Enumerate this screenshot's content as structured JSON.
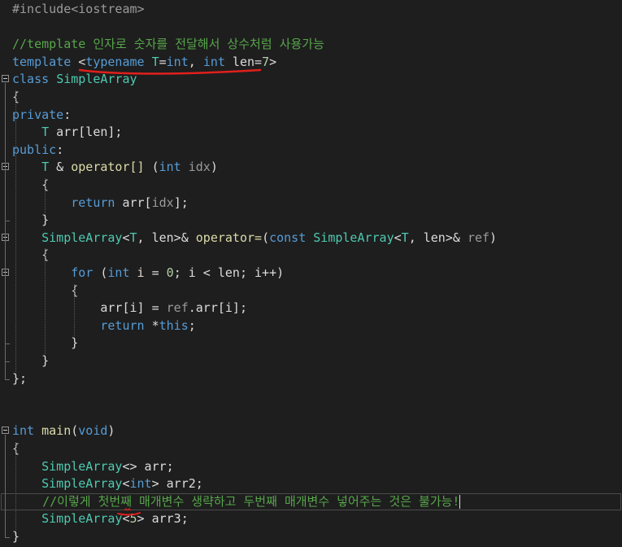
{
  "editor": {
    "lines": [
      [
        {
          "c": "pp",
          "t": "#include<iostream>"
        }
      ],
      [],
      [
        {
          "c": "cm",
          "t": "//template 인자로 숫자를 전달해서 상수처럼 사용가능"
        }
      ],
      [
        {
          "c": "kw",
          "t": "template"
        },
        {
          "c": "tx",
          "t": " <"
        },
        {
          "c": "kw",
          "t": "typename"
        },
        {
          "c": "tx",
          "t": " "
        },
        {
          "c": "ty",
          "t": "T"
        },
        {
          "c": "tx",
          "t": "="
        },
        {
          "c": "kw",
          "t": "int"
        },
        {
          "c": "tx",
          "t": ", "
        },
        {
          "c": "kw",
          "t": "int"
        },
        {
          "c": "tx",
          "t": " len="
        },
        {
          "c": "nm",
          "t": "7"
        },
        {
          "c": "tx",
          "t": ">"
        }
      ],
      [
        {
          "c": "kw",
          "t": "class"
        },
        {
          "c": "tx",
          "t": " "
        },
        {
          "c": "ty",
          "t": "SimpleArray"
        }
      ],
      [
        {
          "c": "tx",
          "t": "{"
        }
      ],
      [
        {
          "c": "kw",
          "t": "private"
        },
        {
          "c": "tx",
          "t": ":"
        }
      ],
      [
        {
          "c": "tx",
          "t": "    "
        },
        {
          "c": "ty",
          "t": "T"
        },
        {
          "c": "tx",
          "t": " arr[len];"
        }
      ],
      [
        {
          "c": "kw",
          "t": "public"
        },
        {
          "c": "tx",
          "t": ":"
        }
      ],
      [
        {
          "c": "tx",
          "t": "    "
        },
        {
          "c": "ty",
          "t": "T"
        },
        {
          "c": "tx",
          "t": " & "
        },
        {
          "c": "fn",
          "t": "operator[]"
        },
        {
          "c": "tx",
          "t": " ("
        },
        {
          "c": "kw",
          "t": "int"
        },
        {
          "c": "tx",
          "t": " "
        },
        {
          "c": "pm",
          "t": "idx"
        },
        {
          "c": "tx",
          "t": ")"
        }
      ],
      [
        {
          "c": "tx",
          "t": "    {"
        }
      ],
      [
        {
          "c": "tx",
          "t": "        "
        },
        {
          "c": "kw",
          "t": "return"
        },
        {
          "c": "tx",
          "t": " arr["
        },
        {
          "c": "pm",
          "t": "idx"
        },
        {
          "c": "tx",
          "t": "];"
        }
      ],
      [
        {
          "c": "tx",
          "t": "    }"
        }
      ],
      [
        {
          "c": "tx",
          "t": "    "
        },
        {
          "c": "ty",
          "t": "SimpleArray"
        },
        {
          "c": "tx",
          "t": "<"
        },
        {
          "c": "ty",
          "t": "T"
        },
        {
          "c": "tx",
          "t": ", len>& "
        },
        {
          "c": "fn",
          "t": "operator="
        },
        {
          "c": "tx",
          "t": "("
        },
        {
          "c": "kw",
          "t": "const"
        },
        {
          "c": "tx",
          "t": " "
        },
        {
          "c": "ty",
          "t": "SimpleArray"
        },
        {
          "c": "tx",
          "t": "<"
        },
        {
          "c": "ty",
          "t": "T"
        },
        {
          "c": "tx",
          "t": ", len>& "
        },
        {
          "c": "pm",
          "t": "ref"
        },
        {
          "c": "tx",
          "t": ")"
        }
      ],
      [
        {
          "c": "tx",
          "t": "    {"
        }
      ],
      [
        {
          "c": "tx",
          "t": "        "
        },
        {
          "c": "kw",
          "t": "for"
        },
        {
          "c": "tx",
          "t": " ("
        },
        {
          "c": "kw",
          "t": "int"
        },
        {
          "c": "tx",
          "t": " i = "
        },
        {
          "c": "nm",
          "t": "0"
        },
        {
          "c": "tx",
          "t": "; i < len; i++)"
        }
      ],
      [
        {
          "c": "tx",
          "t": "        {"
        }
      ],
      [
        {
          "c": "tx",
          "t": "            arr[i] = "
        },
        {
          "c": "pm",
          "t": "ref"
        },
        {
          "c": "tx",
          "t": ".arr[i];"
        }
      ],
      [
        {
          "c": "tx",
          "t": "            "
        },
        {
          "c": "kw",
          "t": "return"
        },
        {
          "c": "tx",
          "t": " *"
        },
        {
          "c": "kw",
          "t": "this"
        },
        {
          "c": "tx",
          "t": ";"
        }
      ],
      [
        {
          "c": "tx",
          "t": "        }"
        }
      ],
      [
        {
          "c": "tx",
          "t": "    }"
        }
      ],
      [
        {
          "c": "tx",
          "t": "};"
        }
      ],
      [],
      [],
      [
        {
          "c": "kw",
          "t": "int"
        },
        {
          "c": "tx",
          "t": " "
        },
        {
          "c": "fn",
          "t": "main"
        },
        {
          "c": "tx",
          "t": "("
        },
        {
          "c": "kw",
          "t": "void"
        },
        {
          "c": "tx",
          "t": ")"
        }
      ],
      [
        {
          "c": "tx",
          "t": "{"
        }
      ],
      [
        {
          "c": "tx",
          "t": "    "
        },
        {
          "c": "ty",
          "t": "SimpleArray"
        },
        {
          "c": "tx",
          "t": "<> arr;"
        }
      ],
      [
        {
          "c": "tx",
          "t": "    "
        },
        {
          "c": "ty",
          "t": "SimpleArray"
        },
        {
          "c": "tx",
          "t": "<"
        },
        {
          "c": "kw",
          "t": "int"
        },
        {
          "c": "tx",
          "t": "> arr2;"
        }
      ],
      [
        {
          "c": "tx",
          "t": "    "
        },
        {
          "c": "cm",
          "t": "//이렇게 첫번째 매개변수 생략하고 두번째 매개변수 넣어주는 것은 불가능!"
        }
      ],
      [
        {
          "c": "tx",
          "t": "    "
        },
        {
          "c": "ty",
          "t": "SimpleArray"
        },
        {
          "c": "tx",
          "t": "<"
        },
        {
          "c": "nm",
          "t": "5"
        },
        {
          "c": "tx",
          "t": "> arr3;"
        }
      ],
      [
        {
          "c": "tx",
          "t": "}"
        }
      ]
    ],
    "current_line_index": 28,
    "fold_markers": [
      4,
      9,
      13,
      15,
      24
    ],
    "colors": {
      "background": "#1e1e1e",
      "keyword": "#569cd6",
      "type": "#4ec9b0",
      "comment": "#57a64a",
      "annotation": "#e0201c"
    }
  }
}
